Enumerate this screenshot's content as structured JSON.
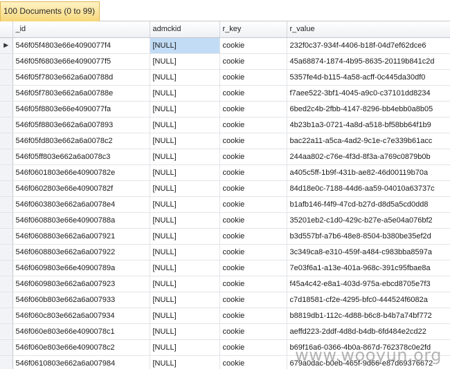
{
  "tab": {
    "label": "100 Documents (0 to 99)"
  },
  "columns": [
    "_id",
    "admckid",
    "r_key",
    "r_value"
  ],
  "current_row_marker": "▶",
  "rows": [
    [
      "546f05f4803e66e4090077f4",
      "[NULL]",
      "cookie",
      "232f0c37-934f-4406-b18f-04d7ef62dce6"
    ],
    [
      "546f05f6803e66e4090077f5",
      "[NULL]",
      "cookie",
      "45a68874-1874-4b95-8635-20119b841c2d"
    ],
    [
      "546f05f7803e662a6a00788d",
      "[NULL]",
      "cookie",
      "5357fe4d-b115-4a58-acff-0c445da30df0"
    ],
    [
      "546f05f7803e662a6a00788e",
      "[NULL]",
      "cookie",
      "f7aee522-3bf1-4045-a9c0-c37101dd8234"
    ],
    [
      "546f05f8803e66e4090077fa",
      "[NULL]",
      "cookie",
      "6bed2c4b-2fbb-4147-8296-bb4ebb0a8b05"
    ],
    [
      "546f05f8803e662a6a007893",
      "[NULL]",
      "cookie",
      "4b23b1a3-0721-4a8d-a518-bf58bb64f1b9"
    ],
    [
      "546f05fd803e662a6a0078c2",
      "[NULL]",
      "cookie",
      "bac22a11-a5ca-4ad2-9c1e-c7e339b61acc"
    ],
    [
      "546f05ff803e662a6a0078c3",
      "[NULL]",
      "cookie",
      "244aa802-c76e-4f3d-8f3a-a769c0879b0b"
    ],
    [
      "546f0601803e66e40900782e",
      "[NULL]",
      "cookie",
      "a405c5ff-1b9f-431b-ae82-46d00119b70a"
    ],
    [
      "546f0602803e66e40900782f",
      "[NULL]",
      "cookie",
      "84d18e0c-7188-44d6-aa59-04010a63737c"
    ],
    [
      "546f0603803e662a6a0078e4",
      "[NULL]",
      "cookie",
      "b1afb146-f4f9-47cd-b27d-d8d5a5cd0dd8"
    ],
    [
      "546f0608803e66e40900788a",
      "[NULL]",
      "cookie",
      "35201eb2-c1d0-429c-b27e-a5e04a076bf2"
    ],
    [
      "546f0608803e662a6a007921",
      "[NULL]",
      "cookie",
      "b3d557bf-a7b6-48e8-8504-b380be35ef2d"
    ],
    [
      "546f0608803e662a6a007922",
      "[NULL]",
      "cookie",
      "3c349ca8-e310-459f-a484-c983bba8597a"
    ],
    [
      "546f0609803e66e40900789a",
      "[NULL]",
      "cookie",
      "7e03f6a1-a13e-401a-968c-391c95fbae8a"
    ],
    [
      "546f0609803e662a6a007923",
      "[NULL]",
      "cookie",
      "f45a4c42-e8a1-403d-975a-ebcd8705e7f3"
    ],
    [
      "546f060b803e662a6a007933",
      "[NULL]",
      "cookie",
      "c7d18581-cf2e-4295-bfc0-444524f6082a"
    ],
    [
      "546f060c803e662a6a007934",
      "[NULL]",
      "cookie",
      "b8819db1-112c-4d88-b6c8-b4b7a74bf772"
    ],
    [
      "546f060e803e66e4090078c1",
      "[NULL]",
      "cookie",
      "aeffd223-2ddf-4d8d-b4db-6fd484e2cd22"
    ],
    [
      "546f060e803e66e4090078c2",
      "[NULL]",
      "cookie",
      "b69f16a6-0366-4b0a-867d-762378c0e2fd"
    ],
    [
      "546f0610803e662a6a007984",
      "[NULL]",
      "cookie",
      "679a0dac-b0eb-465f-9d66-e87d69376672"
    ]
  ],
  "watermark": "www.wooyun.org"
}
